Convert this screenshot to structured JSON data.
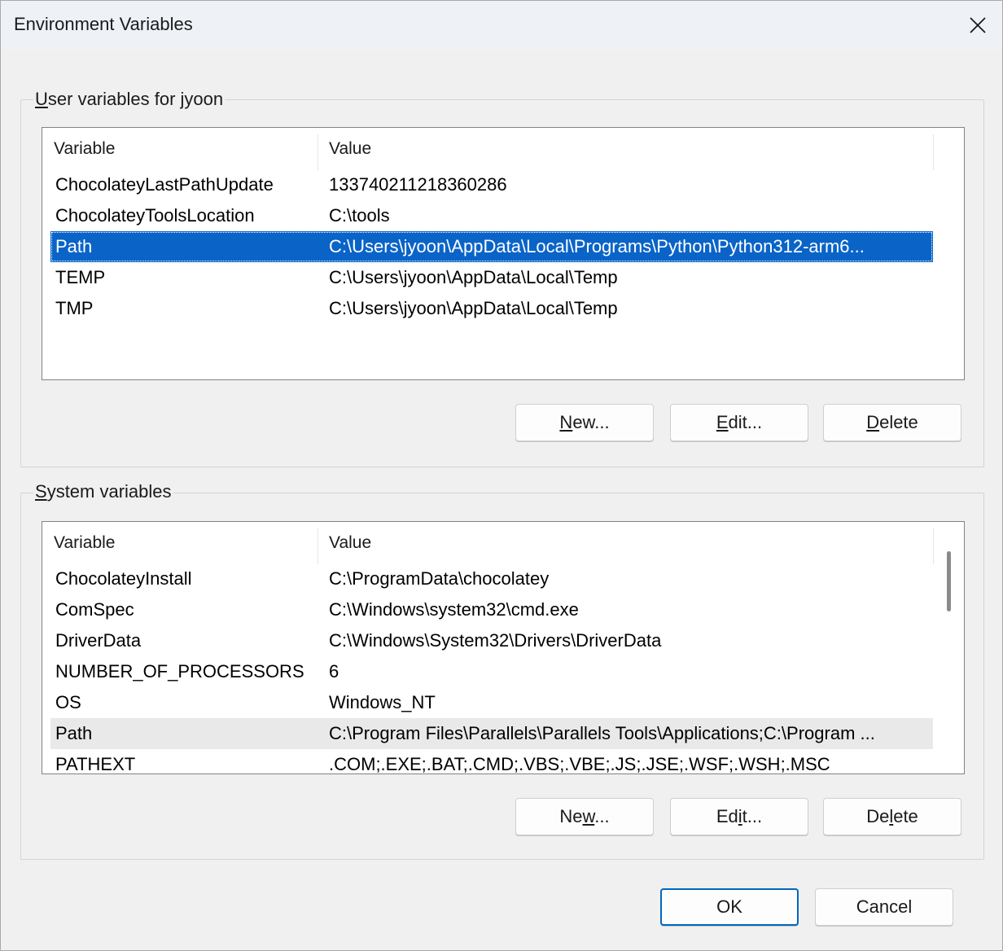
{
  "window": {
    "title": "Environment Variables"
  },
  "user_group": {
    "label_accel": "U",
    "label_rest": "ser variables for jyoon",
    "columns": [
      "Variable",
      "Value"
    ],
    "rows": [
      {
        "name": "ChocolateyLastPathUpdate",
        "value": "133740211218360286"
      },
      {
        "name": "ChocolateyToolsLocation",
        "value": "C:\\tools"
      },
      {
        "name": "Path",
        "value": "C:\\Users\\jyoon\\AppData\\Local\\Programs\\Python\\Python312-arm6..."
      },
      {
        "name": "TEMP",
        "value": "C:\\Users\\jyoon\\AppData\\Local\\Temp"
      },
      {
        "name": "TMP",
        "value": "C:\\Users\\jyoon\\AppData\\Local\\Temp"
      }
    ],
    "selected_row": "Path",
    "buttons": {
      "new": {
        "accel": "N",
        "rest": "ew..."
      },
      "edit": {
        "accel": "E",
        "rest": "dit..."
      },
      "delete": {
        "accel": "D",
        "rest": "elete"
      }
    }
  },
  "system_group": {
    "label_accel": "S",
    "label_rest": "ystem variables",
    "columns": [
      "Variable",
      "Value"
    ],
    "rows": [
      {
        "name": "ChocolateyInstall",
        "value": "C:\\ProgramData\\chocolatey"
      },
      {
        "name": "ComSpec",
        "value": "C:\\Windows\\system32\\cmd.exe"
      },
      {
        "name": "DriverData",
        "value": "C:\\Windows\\System32\\Drivers\\DriverData"
      },
      {
        "name": "NUMBER_OF_PROCESSORS",
        "value": "6"
      },
      {
        "name": "OS",
        "value": "Windows_NT"
      },
      {
        "name": "Path",
        "value": "C:\\Program Files\\Parallels\\Parallels Tools\\Applications;C:\\Program ..."
      },
      {
        "name": "PATHEXT",
        "value": ".COM;.EXE;.BAT;.CMD;.VBS;.VBE;.JS;.JSE;.WSF;.WSH;.MSC"
      }
    ],
    "hovered_row": "Path",
    "buttons": {
      "new": {
        "pre": "Ne",
        "accel": "w",
        "rest": "..."
      },
      "edit": {
        "pre": "Ed",
        "accel": "i",
        "rest": "t..."
      },
      "delete": {
        "pre": "De",
        "accel": "l",
        "rest": "ete"
      }
    }
  },
  "footer": {
    "ok_label": "OK",
    "cancel_label": "Cancel"
  },
  "colors": {
    "selection": "#0a64c8",
    "primary_border": "#0067c0"
  }
}
